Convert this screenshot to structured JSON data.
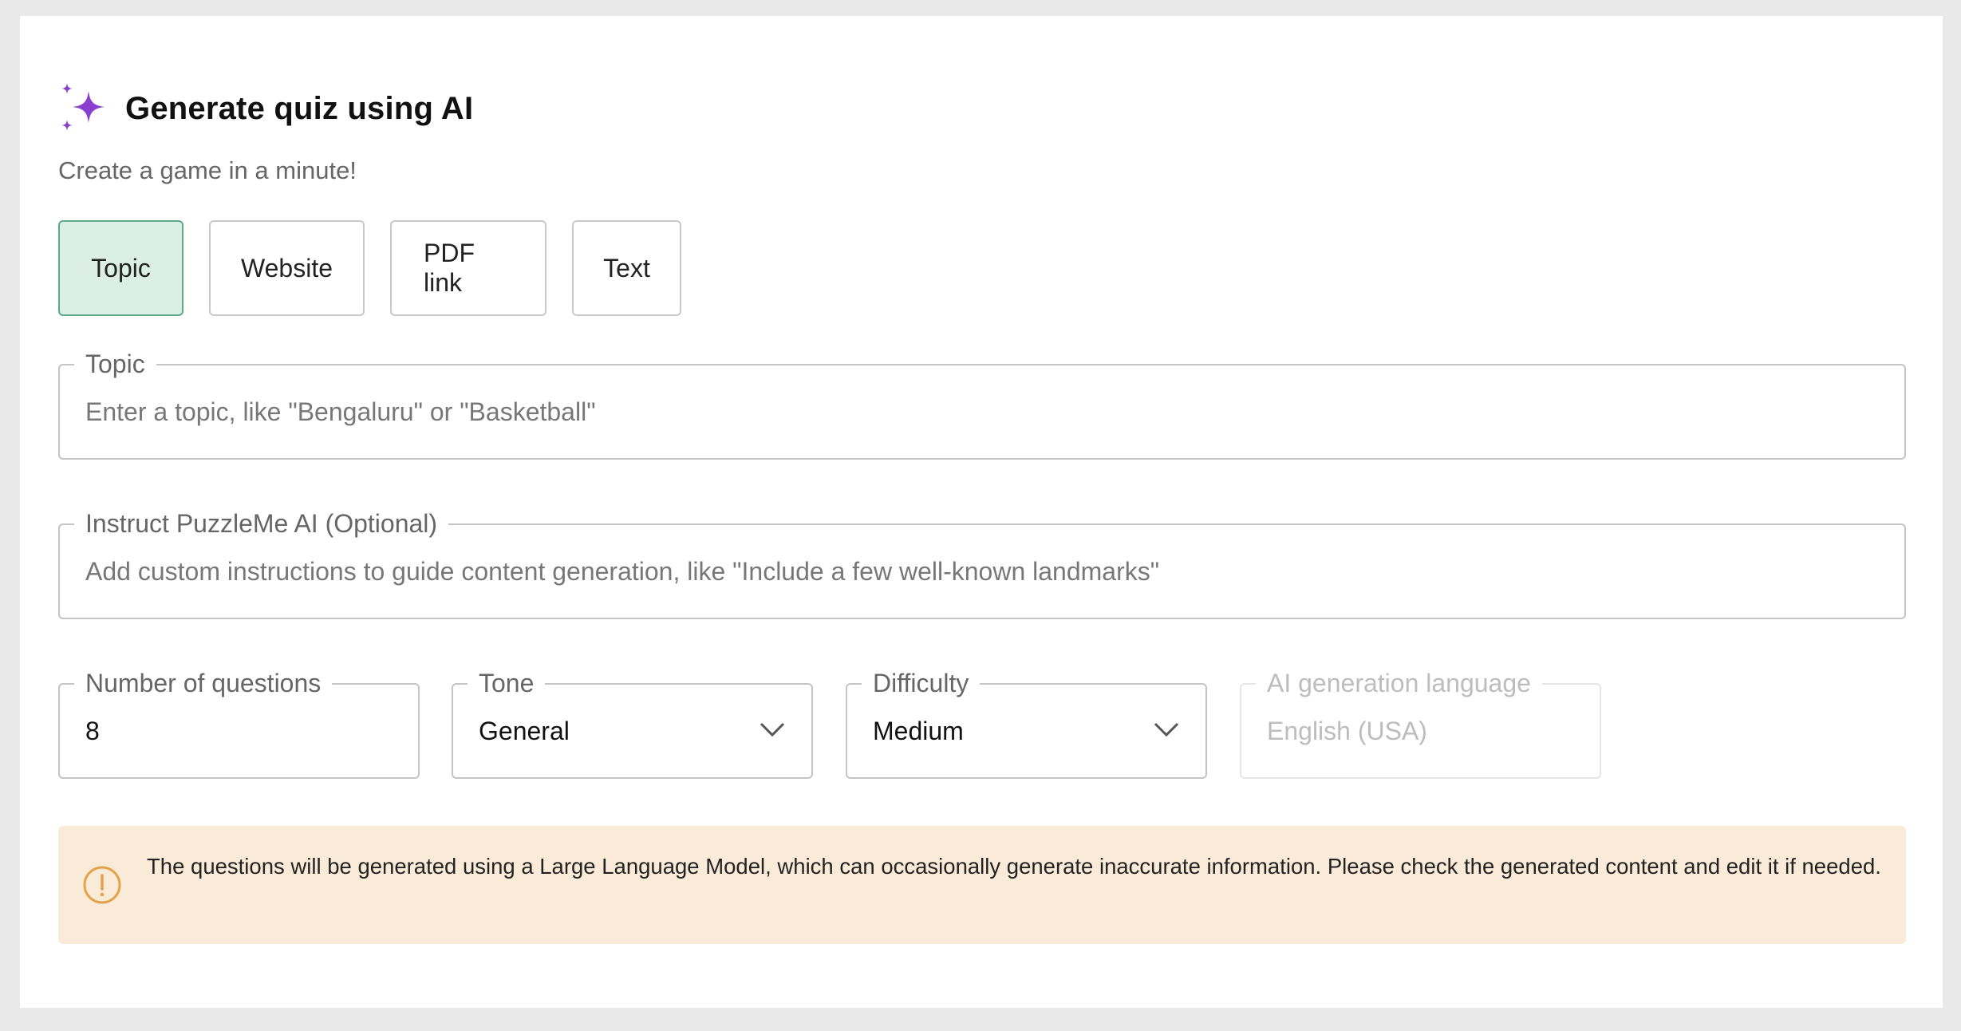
{
  "header": {
    "title": "Generate quiz using AI",
    "subtitle": "Create a game in a minute!",
    "icon": "sparkle-icon",
    "icon_color": "#8a3fcf"
  },
  "tabs": [
    {
      "label": "Topic",
      "active": true
    },
    {
      "label": "Website",
      "active": false
    },
    {
      "label": "PDF link",
      "active": false
    },
    {
      "label": "Text",
      "active": false
    }
  ],
  "topic_field": {
    "label": "Topic",
    "value": "",
    "placeholder": "Enter a topic, like \"Bengaluru\" or \"Basketball\""
  },
  "instruct_field": {
    "label": "Instruct PuzzleMe AI (Optional)",
    "value": "",
    "placeholder": "Add custom instructions to guide content generation, like \"Include a few well-known landmarks\""
  },
  "questions_field": {
    "label": "Number of questions",
    "value": "8"
  },
  "tone_field": {
    "label": "Tone",
    "value": "General"
  },
  "difficulty_field": {
    "label": "Difficulty",
    "value": "Medium"
  },
  "language_field": {
    "label": "AI generation language",
    "value": "English (USA)",
    "disabled": true
  },
  "notice": {
    "icon": "warning-circle-icon",
    "text": "The questions will be generated using a Large Language Model, which can occasionally generate inaccurate information. Please check the generated content and edit it if needed.",
    "background": "#faebd8",
    "icon_color": "#e6a24a"
  },
  "colors": {
    "active_tab_bg": "#dcefe6",
    "active_tab_border": "#5aa987"
  }
}
